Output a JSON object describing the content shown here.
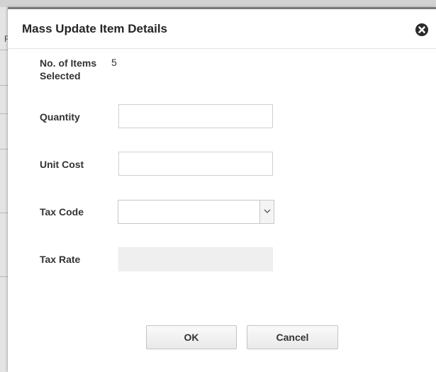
{
  "dialog": {
    "title": "Mass Update Item Details",
    "close_icon": "close-circle-icon"
  },
  "fields": {
    "items_selected": {
      "label_line1": "No. of Items",
      "label_line2": "Selected",
      "value": "5"
    },
    "quantity": {
      "label": "Quantity",
      "value": "",
      "placeholder": ""
    },
    "unit_cost": {
      "label": "Unit Cost",
      "value": "",
      "placeholder": ""
    },
    "tax_code": {
      "label": "Tax Code",
      "value": "",
      "arrow_icon": "chevron-down-icon"
    },
    "tax_rate": {
      "label": "Tax Rate",
      "value": ""
    }
  },
  "buttons": {
    "ok": "OK",
    "cancel": "Cancel"
  },
  "background": {
    "partial_text": "F"
  }
}
